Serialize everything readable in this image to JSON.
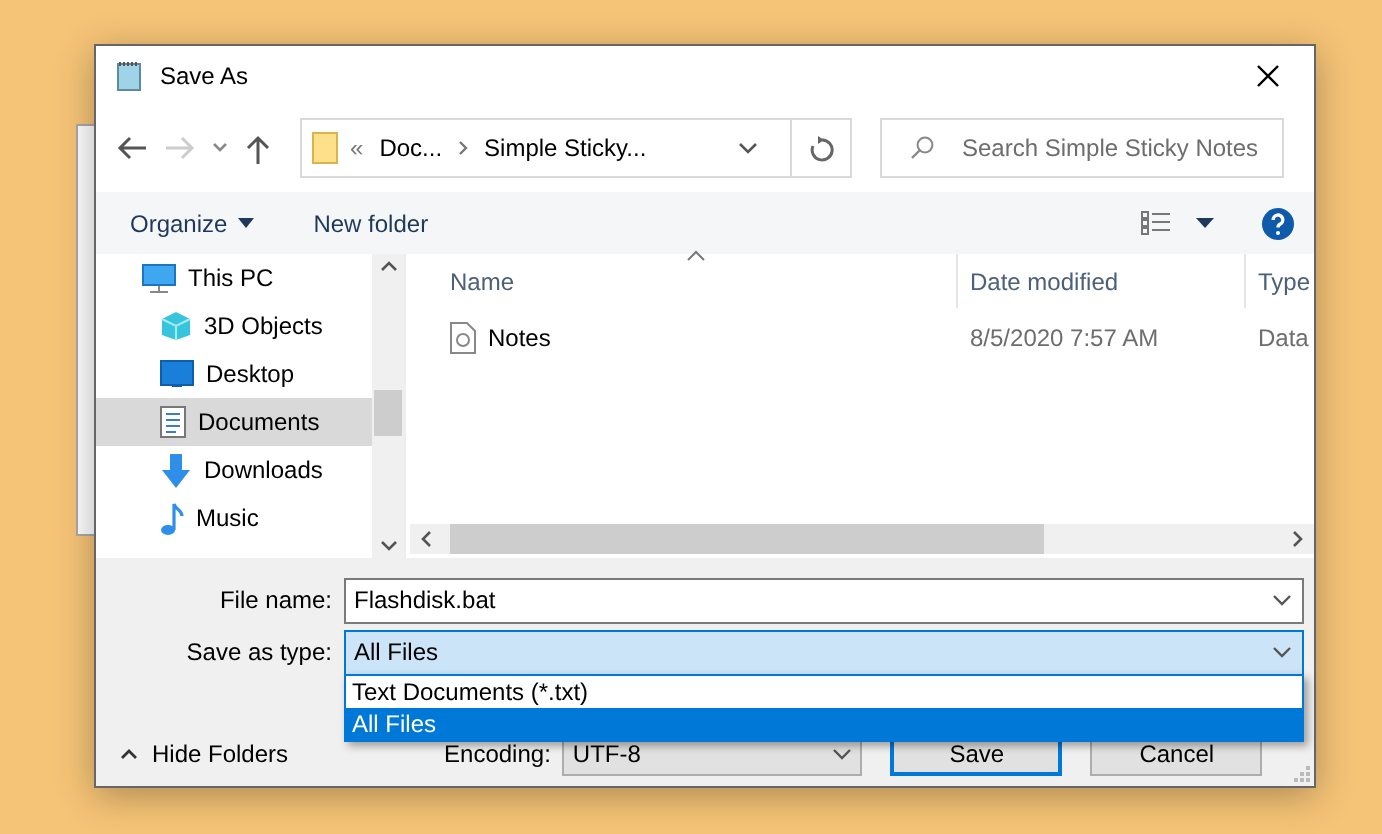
{
  "window": {
    "title": "Save As"
  },
  "address_bar": {
    "prefix": "«",
    "path": [
      "Doc...",
      "Simple Sticky..."
    ]
  },
  "search": {
    "placeholder": "Search Simple Sticky Notes"
  },
  "toolbar": [
    {
      "label": "Organize",
      "kind": "menu"
    },
    {
      "label": "New folder",
      "kind": "button"
    }
  ],
  "nav_pane": {
    "items": [
      {
        "label": "This PC",
        "kind": "pc",
        "selected": false,
        "children": [
          {
            "label": "3D Objects",
            "kind": "cube",
            "selected": false
          },
          {
            "label": "Desktop",
            "kind": "desktop",
            "selected": false
          },
          {
            "label": "Documents",
            "kind": "documents",
            "selected": true
          },
          {
            "label": "Downloads",
            "kind": "downloads",
            "selected": false
          },
          {
            "label": "Music",
            "kind": "music",
            "selected": false
          }
        ]
      }
    ]
  },
  "file_list": {
    "columns": [
      "Name",
      "Date modified",
      "Type"
    ],
    "rows": [
      {
        "name": "Notes",
        "date_modified": "8/5/2020 7:57 AM",
        "type": "Data"
      }
    ]
  },
  "file_name": {
    "label": "File name:",
    "value": "Flashdisk.bat"
  },
  "save_as_type": {
    "label": "Save as type:",
    "value": "All Files",
    "expanded": true,
    "options": [
      {
        "label": "Text Documents (*.txt)",
        "selected": false
      },
      {
        "label": "All Files",
        "selected": true
      }
    ]
  },
  "hide_folders": "Hide Folders",
  "encoding": {
    "label": "Encoding:",
    "value": "UTF-8"
  },
  "buttons": [
    {
      "label": "Save",
      "default": true
    },
    {
      "label": "Cancel",
      "default": false
    }
  ]
}
